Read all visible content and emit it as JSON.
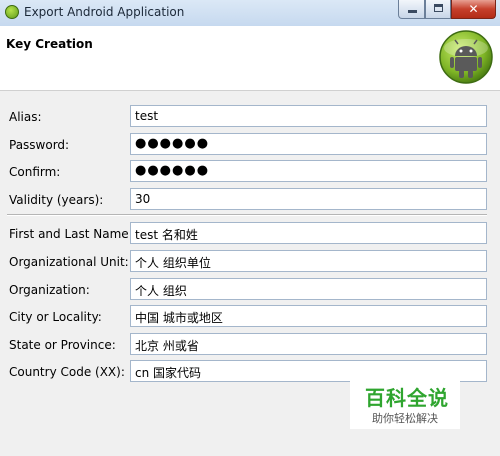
{
  "window": {
    "title": "Export Android Application",
    "icon": "android-app-icon",
    "controls": {
      "minimize": "minimize",
      "maximize": "maximize",
      "close": "✕"
    }
  },
  "header": {
    "title": "Key Creation",
    "logo": "android-logo"
  },
  "fields": {
    "alias": {
      "label": "Alias:",
      "value": "test"
    },
    "password": {
      "label": "Password:",
      "value": "●●●●●●"
    },
    "confirm": {
      "label": "Confirm:",
      "value": "●●●●●●"
    },
    "validity": {
      "label": "Validity (years):",
      "value": "30"
    },
    "name": {
      "label": "First and Last Name:",
      "value": "test    名和姓"
    },
    "org_unit": {
      "label": "Organizational Unit:",
      "value": "个人      组织单位"
    },
    "organization": {
      "label": "Organization:",
      "value": "个人      组织"
    },
    "city": {
      "label": "City or Locality:",
      "value": "中国      城市或地区"
    },
    "state": {
      "label": "State or Province:",
      "value": "北京      州或省"
    },
    "country": {
      "label": "Country Code (XX):",
      "value": "cn   国家代码"
    }
  },
  "watermark": {
    "main": "百科全说",
    "sub": "助你轻松解决"
  },
  "colors": {
    "android_green": "#a4c639",
    "watermark_green": "#2fa52f",
    "field_border": "#a4b6cb"
  }
}
